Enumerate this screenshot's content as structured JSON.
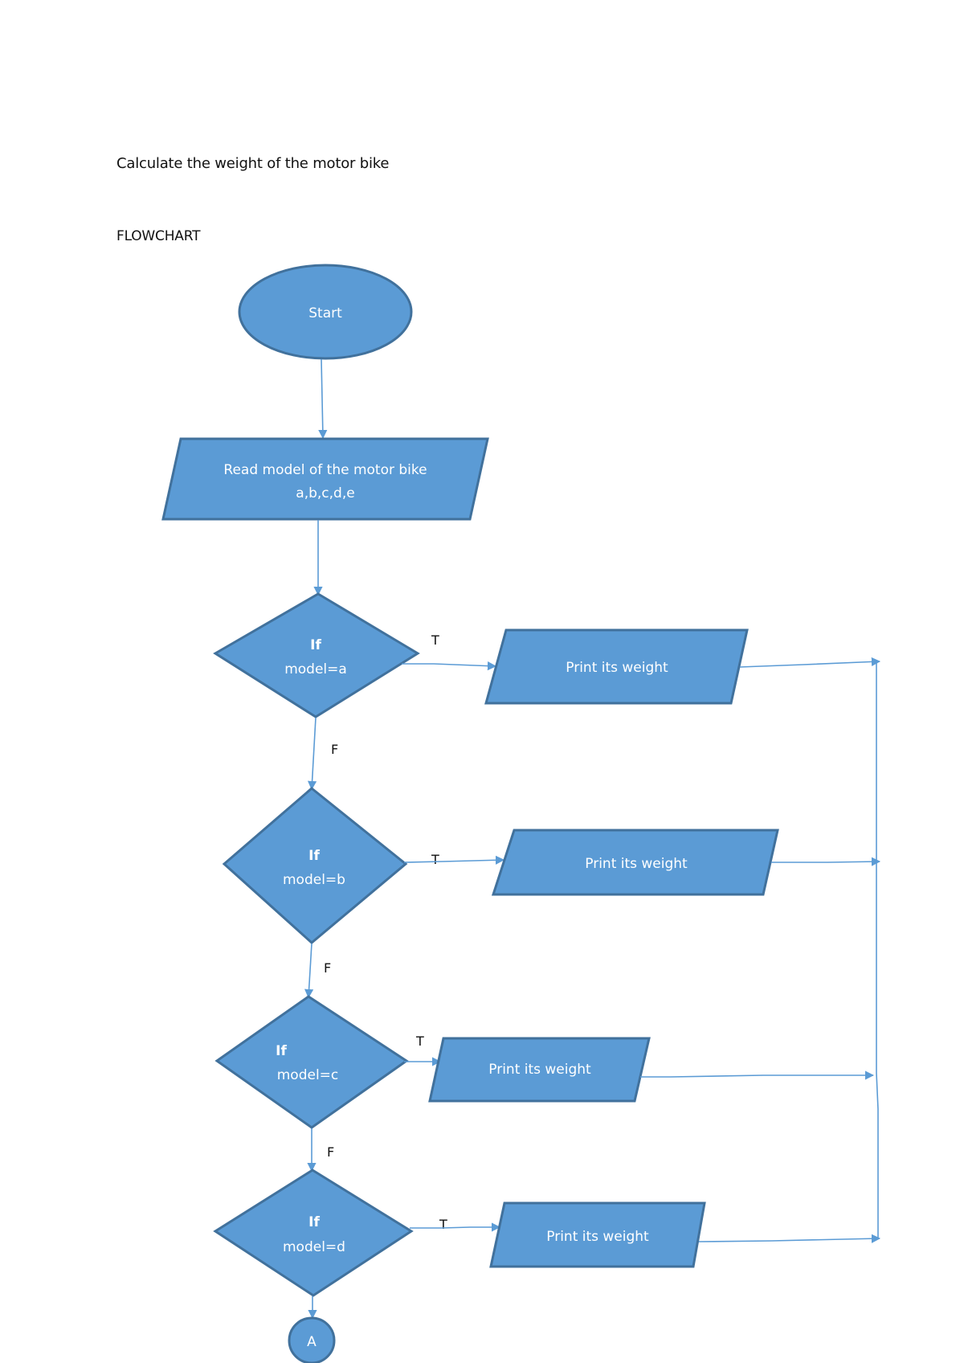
{
  "document": {
    "title": "Calculate the weight of the motor bike",
    "subtitle": "FLOWCHART"
  },
  "flowchart": {
    "start": {
      "label": "Start"
    },
    "input": {
      "line1": "Read model of the motor bike",
      "line2": "a,b,c,d,e"
    },
    "decisions": [
      {
        "keyword": "If",
        "condition": "model=a",
        "true_label": "T",
        "false_label": "F",
        "action": "Print its weight"
      },
      {
        "keyword": "If",
        "condition": "model=b",
        "true_label": "T",
        "false_label": "F",
        "action": "Print its weight"
      },
      {
        "keyword": "If",
        "condition": "model=c",
        "true_label": "T",
        "false_label": "F",
        "action": "Print its weight"
      },
      {
        "keyword": "If",
        "condition": "model=d",
        "true_label": "T",
        "false_label": "",
        "action": "Print its weight"
      }
    ],
    "connector": {
      "label": "A"
    },
    "colors": {
      "fill": "#5b9bd5",
      "stroke": "#41719c",
      "text": "#ffffff"
    }
  }
}
